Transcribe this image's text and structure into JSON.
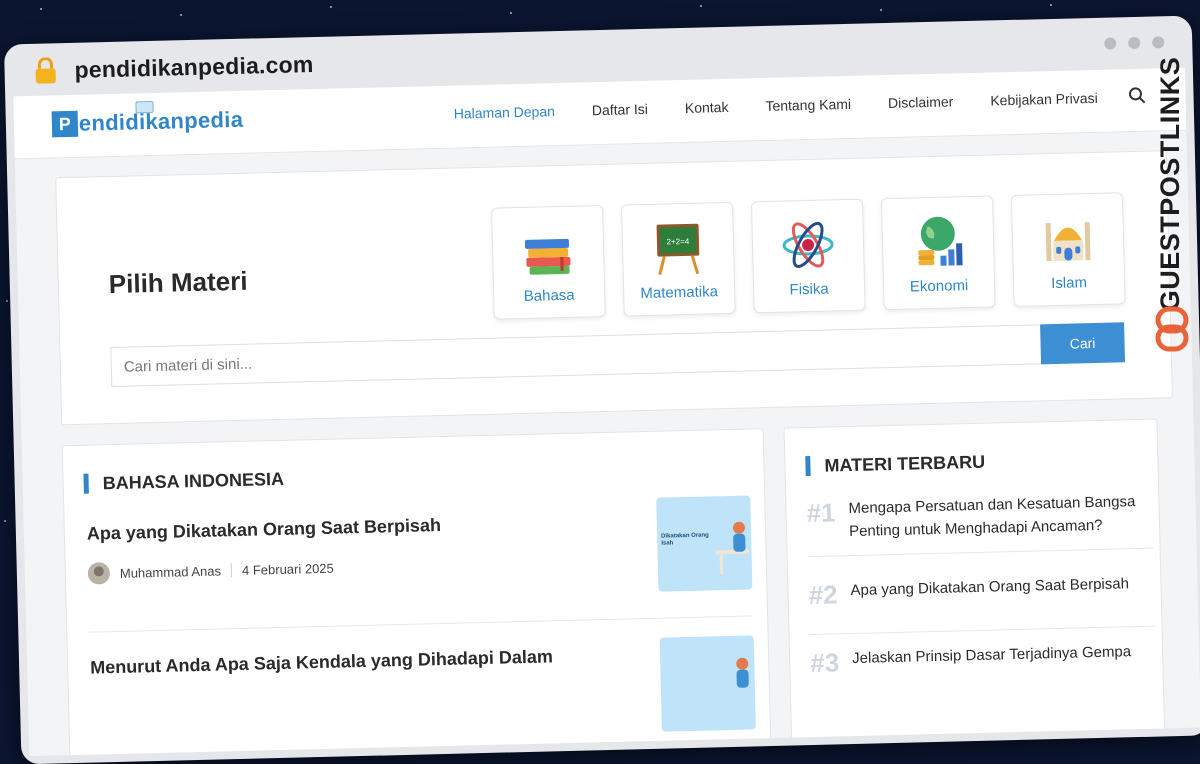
{
  "browser": {
    "url": "pendidikanpedia.com"
  },
  "site": {
    "logo_letter": "P",
    "logo_text": "endidikanpedia",
    "menu": [
      "Halaman Depan",
      "Daftar Isi",
      "Kontak",
      "Tentang Kami",
      "Disclaimer",
      "Kebijakan Privasi"
    ]
  },
  "hero": {
    "title": "Pilih Materi",
    "subjects": [
      {
        "label": "Bahasa",
        "icon": "books-icon"
      },
      {
        "label": "Matematika",
        "icon": "chalkboard-icon"
      },
      {
        "label": "Fisika",
        "icon": "atom-icon"
      },
      {
        "label": "Ekonomi",
        "icon": "globe-coins-icon"
      },
      {
        "label": "Islam",
        "icon": "mosque-icon"
      }
    ],
    "search_placeholder": "Cari materi di sini...",
    "search_button": "Cari"
  },
  "main": {
    "section_title": "BAHASA INDONESIA",
    "posts": [
      {
        "title": "Apa yang Dikatakan Orang Saat Berpisah",
        "author": "Muhammad Anas",
        "date": "4 Februari 2025",
        "thumb_text": "Dikatakan Orang Isah"
      },
      {
        "title": "Menurut Anda Apa Saja Kendala yang Dihadapi Dalam",
        "author": "",
        "date": "",
        "thumb_text": ""
      }
    ]
  },
  "sidebar": {
    "section_title": "MATERI TERBARU",
    "items": [
      {
        "num": "#1",
        "text": "Mengapa Persatuan dan Kesatuan Bangsa Penting untuk Menghadapi Ancaman?"
      },
      {
        "num": "#2",
        "text": "Apa yang Dikatakan Orang Saat Berpisah"
      },
      {
        "num": "#3",
        "text": "Jelaskan Prinsip Dasar Terjadinya Gempa"
      }
    ]
  },
  "watermark": {
    "text": "GUESTPOSTLINKS"
  },
  "colors": {
    "accent": "#2f86c9",
    "button": "#3d8fd3",
    "watermark_logo": "#e8623a"
  }
}
